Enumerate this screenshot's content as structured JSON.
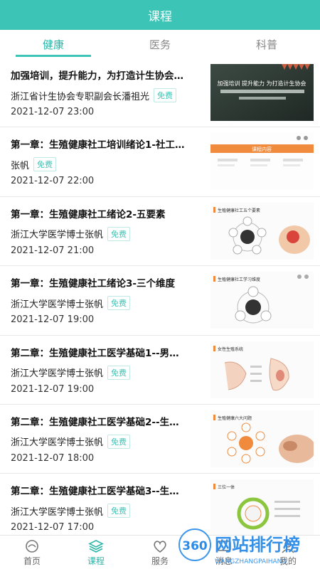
{
  "header": {
    "title": "课程"
  },
  "tabs": [
    {
      "label": "健康",
      "active": true
    },
    {
      "label": "医务",
      "active": false
    },
    {
      "label": "科普",
      "active": false
    }
  ],
  "courses": [
    {
      "title": "加强培训，提升能力，为打造计生协会…",
      "author": "浙江省计生协会专职副会长潘祖光",
      "price": "免费",
      "date": "2021-12-07 23:00",
      "thumb_text": "加强培训 提升能力 为打造计生协会"
    },
    {
      "title": "第一章：生殖健康社工培训绪论1-社工…",
      "author": "张帆",
      "price": "免费",
      "date": "2021-12-07 22:00",
      "thumb_text": "课程内容"
    },
    {
      "title": "第一章：生殖健康社工绪论2-五要素",
      "author": "浙江大学医学博士张帆",
      "price": "免费",
      "date": "2021-12-07 21:00",
      "thumb_text": "生殖健康社工五个要素"
    },
    {
      "title": "第一章：生殖健康社工绪论3-三个维度",
      "author": "浙江大学医学博士张帆",
      "price": "免费",
      "date": "2021-12-07 19:00",
      "thumb_text": "生殖健康社工学习维度"
    },
    {
      "title": "第二章：生殖健康社工医学基础1--男…",
      "author": "浙江大学医学博士张帆",
      "price": "免费",
      "date": "2021-12-07 19:00",
      "thumb_text": "女性生殖系统"
    },
    {
      "title": "第二章：生殖健康社工医学基础2--生…",
      "author": "浙江大学医学博士张帆",
      "price": "免费",
      "date": "2021-12-07 18:00",
      "thumb_text": "生殖健康六大问题"
    },
    {
      "title": "第二章：生殖健康社工医学基础3--生…",
      "author": "浙江大学医学博士张帆",
      "price": "免费",
      "date": "2021-12-07 17:00",
      "thumb_text": "三位一体"
    }
  ],
  "bottom_nav": [
    {
      "label": "首页",
      "icon": "home-icon",
      "active": false
    },
    {
      "label": "课程",
      "icon": "course-icon",
      "active": true
    },
    {
      "label": "服务",
      "icon": "heart-icon",
      "active": false
    },
    {
      "label": "消息",
      "icon": "message-icon",
      "active": false
    },
    {
      "label": "我的",
      "icon": "user-icon",
      "active": false
    }
  ],
  "watermark": {
    "logo": "360",
    "brand": "网站排行榜",
    "url": "WANGZHANGPAIHANG"
  },
  "colors": {
    "accent": "#3cc4b6",
    "tag_border": "#bfe9e4",
    "orange": "#f08a3c"
  }
}
